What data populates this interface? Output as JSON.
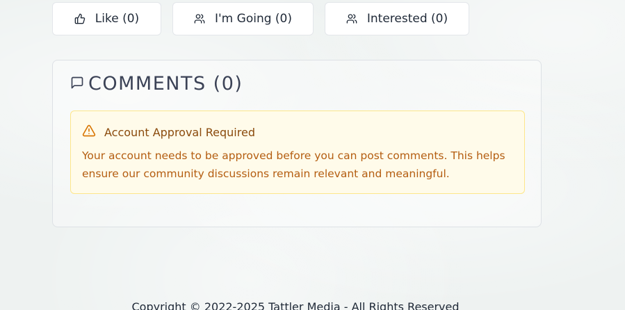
{
  "actions": {
    "like_label": "Like (0)",
    "going_label": "I'm Going (0)",
    "interested_label": "Interested (0)"
  },
  "comments": {
    "title": "COMMENTS (0)",
    "alert": {
      "heading": "Account Approval Required",
      "body": "Your account needs to be approved before you can post comments. This helps ensure our community discussions remain relevant and meaningful."
    }
  },
  "footer": {
    "copyright": "Copyright © 2022-2025 Tattler Media - All Rights Reserved"
  },
  "icons": {
    "like": "thumbs-up-icon",
    "going": "users-icon",
    "interested": "users-icon",
    "comments": "message-square-icon",
    "alert": "alert-triangle-icon"
  },
  "colors": {
    "alert_background": "#fffbea",
    "alert_border": "#fde68a",
    "alert_text": "#b45d10",
    "title_text": "#3b4256"
  }
}
